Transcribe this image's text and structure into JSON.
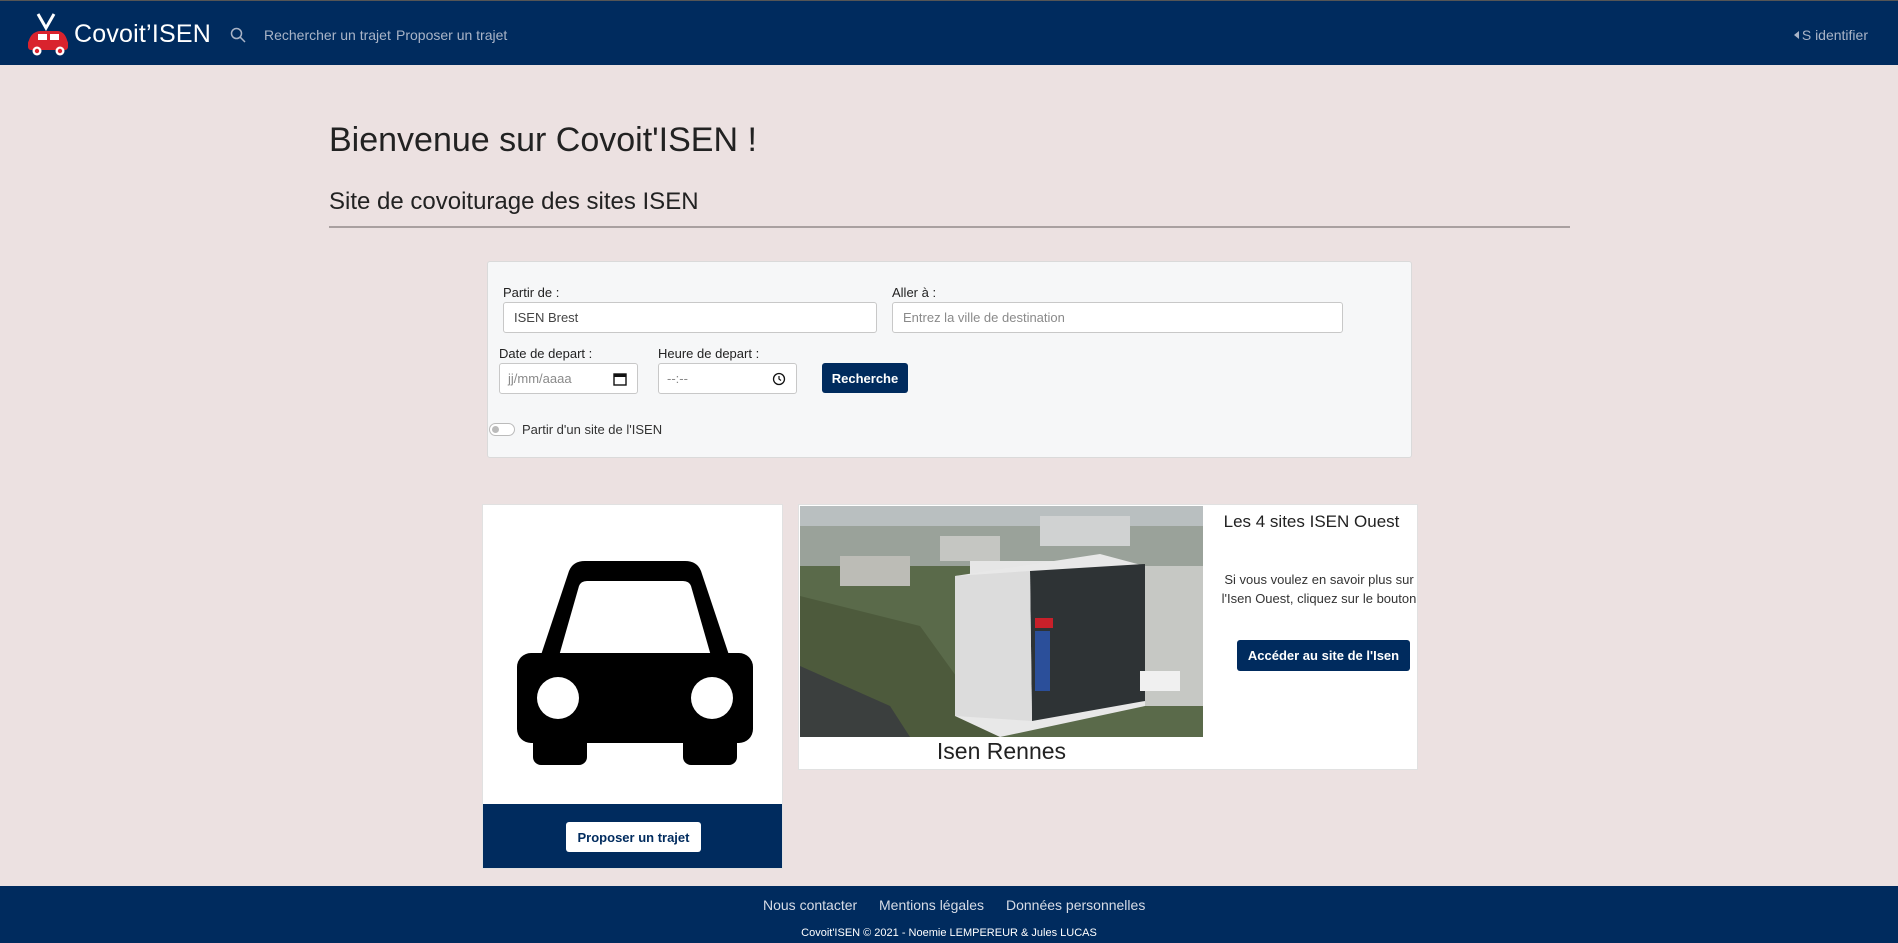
{
  "navbar": {
    "brand": "Covoit’ISEN",
    "links": [
      "Rechercher un trajet",
      "Proposer un trajet"
    ],
    "login": "S identifier"
  },
  "hero": {
    "title": "Bienvenue sur Covoit'ISEN !",
    "subtitle": "Site de covoiturage des sites ISEN"
  },
  "search_form": {
    "from_label": "Partir de :",
    "from_value": "ISEN Brest",
    "to_label": "Aller à :",
    "to_placeholder": "Entrez la ville de destination",
    "date_label": "Date de depart :",
    "date_placeholder": "jj/mm/aaaa",
    "time_label": "Heure de depart :",
    "time_placeholder": "--:--",
    "submit": "Recherche",
    "toggle_label": "Partir d'un site de l'ISEN",
    "toggle_on": false
  },
  "car_card": {
    "button": "Proposer un trajet"
  },
  "info_card": {
    "caption": "Isen Rennes",
    "title": "Les 4 sites ISEN Ouest",
    "text": "Si vous voulez en savoir plus sur l'Isen Ouest, cliquez sur le bouton",
    "button": "Accéder au site de l'Isen"
  },
  "footer": {
    "links": [
      "Nous contacter",
      "Mentions légales",
      "Données personnelles"
    ],
    "copyright": "Covoit'ISEN © 2021 - Noemie LEMPEREUR & Jules LUCAS"
  },
  "colors": {
    "primary": "#002b5e",
    "background": "#ece1e1"
  }
}
